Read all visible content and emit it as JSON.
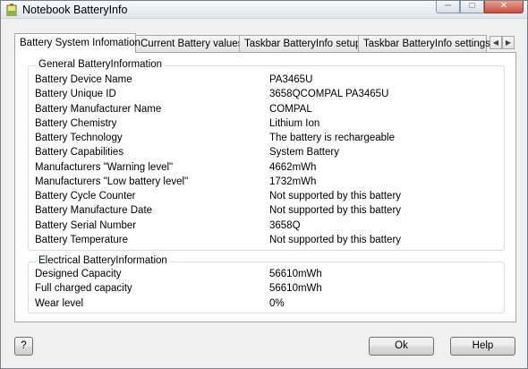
{
  "window": {
    "title": "Notebook BatteryInfo",
    "min_glyph": "─",
    "max_glyph": "□",
    "close_glyph": "✕"
  },
  "tabs": [
    {
      "label": "Battery System Infomation",
      "active": true
    },
    {
      "label": "Current Battery values",
      "active": false
    },
    {
      "label": "Taskbar BatteryInfo setup",
      "active": false
    },
    {
      "label": "Taskbar BatteryInfo settings",
      "active": false
    }
  ],
  "tab_scroll": {
    "left": "◀",
    "right": "▶"
  },
  "general": {
    "title": "General BatteryInformation",
    "rows": [
      {
        "label": "Battery Device Name",
        "value": "PA3465U"
      },
      {
        "label": "Battery Unique ID",
        "value": "3658QCOMPAL PA3465U"
      },
      {
        "label": "Battery Manufacturer Name",
        "value": "COMPAL"
      },
      {
        "label": "Battery Chemistry",
        "value": "Lithium Ion"
      },
      {
        "label": "Battery Technology",
        "value": "The battery is rechargeable"
      },
      {
        "label": "Battery Capabilities",
        "value": "System Battery"
      },
      {
        "label": "Manufacturers \"Warning level\"",
        "value": "4662mWh"
      },
      {
        "label": "Manufacturers \"Low battery level\"",
        "value": "1732mWh"
      },
      {
        "label": "Battery Cycle Counter",
        "value": "Not supported by this battery"
      },
      {
        "label": "Battery Manufacture Date",
        "value": "Not supported by this battery"
      },
      {
        "label": "Battery Serial Number",
        "value": "3658Q"
      },
      {
        "label": "Battery Temperature",
        "value": "Not supported by this battery"
      }
    ]
  },
  "electrical": {
    "title": "Electrical BatteryInformation",
    "rows": [
      {
        "label": "Designed Capacity",
        "value": "56610mWh"
      },
      {
        "label": "Full charged capacity",
        "value": "56610mWh"
      },
      {
        "label": "Wear level",
        "value": "0%"
      }
    ]
  },
  "buttons": {
    "help_q": "?",
    "ok": "Ok",
    "help": "Help"
  }
}
